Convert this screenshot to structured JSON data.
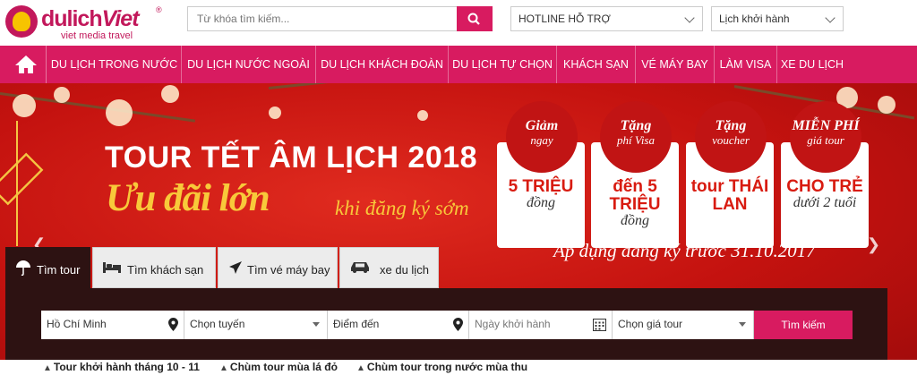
{
  "brand": {
    "name_part1": "dulich",
    "name_part2": "Viet",
    "registered": "®",
    "tagline": "viet media travel",
    "accent": "#d81b60"
  },
  "search": {
    "placeholder": "Từ khóa tìm kiếm...",
    "button_icon": "search-icon"
  },
  "hotline": {
    "label": "HOTLINE HỖ TRỢ"
  },
  "schedule": {
    "label": "Lịch khởi hành"
  },
  "nav": {
    "home_icon": "home-icon",
    "items": [
      {
        "label": "DU LỊCH TRONG NƯỚC"
      },
      {
        "label": "DU LỊCH NƯỚC NGOÀI"
      },
      {
        "label": "DU LỊCH KHÁCH ĐOÀN"
      },
      {
        "label": "DU LỊCH TỰ CHỌN"
      },
      {
        "label": "KHÁCH SẠN"
      },
      {
        "label": "VÉ MÁY BAY"
      },
      {
        "label": "LÀM VISA"
      },
      {
        "label": "XE DU LỊCH"
      }
    ]
  },
  "banner": {
    "title": "TOUR TẾT ÂM LỊCH 2018",
    "subtitle": "Ưu đãi lớn",
    "subtitle2": "khi đăng ký sớm",
    "offers": [
      {
        "top1": "Giảm",
        "top2": "ngay",
        "main1": "5 TRIỆU",
        "main2": "đồng"
      },
      {
        "top1": "Tặng",
        "top2": "phí Visa",
        "main1": "đến 5 TRIỆU",
        "main2": "đồng"
      },
      {
        "top1": "Tặng",
        "top2": "voucher",
        "main1": "tour THÁI LAN",
        "main2": ""
      },
      {
        "top1": "MIỄN PHÍ",
        "top2": "giá tour",
        "main1": "CHO TRẺ",
        "main2": "dưới 2 tuổi"
      }
    ],
    "note": "Áp dụng đăng ký trước 31.10.2017"
  },
  "tabs": [
    {
      "label": "Tìm tour",
      "icon": "umbrella-icon",
      "active": true
    },
    {
      "label": "Tìm khách sạn",
      "icon": "bed-icon",
      "active": false
    },
    {
      "label": "Tìm vé máy bay",
      "icon": "plane-icon",
      "active": false
    },
    {
      "label": "xe du lịch",
      "icon": "car-icon",
      "active": false
    }
  ],
  "form": {
    "origin": "Hồ Chí Minh",
    "route": "Chọn tuyến",
    "destination": "Điểm đến",
    "date_placeholder": "Ngày khởi hành",
    "price": "Chọn giá tour",
    "submit": "Tìm kiếm"
  },
  "links": [
    {
      "label": "Tour khởi hành tháng 10 - 11"
    },
    {
      "label": "Chùm tour mùa lá đỏ"
    },
    {
      "label": "Chùm tour trong nước mùa thu"
    }
  ]
}
